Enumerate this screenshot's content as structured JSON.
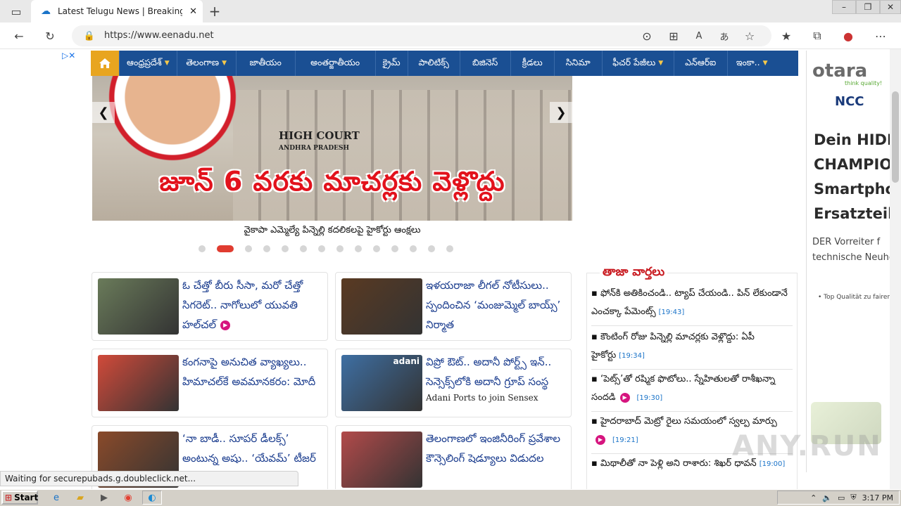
{
  "browser": {
    "tab_title": "Latest Telugu News | Breaking Ne",
    "url": "https://www.eenadu.net",
    "status_text": "Waiting for securepubads.g.doubleclick.net..."
  },
  "nav": {
    "items": [
      {
        "label": "ఆంధ్రప్రదేశ్",
        "dropdown": true
      },
      {
        "label": "తెలంగాణ",
        "dropdown": true
      },
      {
        "label": "జాతీయం",
        "dropdown": false
      },
      {
        "label": "అంతర్జాతీయం",
        "dropdown": false
      },
      {
        "label": "క్రైమ్",
        "dropdown": false
      },
      {
        "label": "పాలిటిక్స్",
        "dropdown": false
      },
      {
        "label": "బిజినెస్",
        "dropdown": false
      },
      {
        "label": "క్రీడలు",
        "dropdown": false
      },
      {
        "label": "సినిమా",
        "dropdown": false
      },
      {
        "label": "ఫీచర్ పేజీలు",
        "dropdown": true
      },
      {
        "label": "ఎన్‌ఆర్‌ఐ",
        "dropdown": false
      },
      {
        "label": "ఇంకా..",
        "dropdown": true
      }
    ]
  },
  "hero": {
    "headline": "జూన్ 6 వరకు మాచర్లకు వెళ్లొద్దు",
    "building_sign": "HIGH COURT",
    "building_sign_sub": "ANDHRA PRADESH",
    "caption": "వైకాపా ఎమ్మెల్యే పిన్నెల్లి కదలికలపై హైకోర్టు ఆంక్షలు",
    "slides": 14,
    "active_slide": 2
  },
  "cards": [
    {
      "text": "ఓ చేత్తో బీరు సీసా, మరో చేత్తో సిగరెట్‌.. నాగోలులో యువతి హల్‌చల్",
      "video": true,
      "thumb_color": "#6a7b5a"
    },
    {
      "text": "ఇళయరాజా లీగల్‌ నోటీసులు.. స్పందించిన ‘మంజుమ్మెల్‌ బాయ్స్‌’ నిర్మాత",
      "video": false,
      "thumb_color": "#5a3a22"
    },
    {
      "text": "కంగనాపై అనుచిత వ్యాఖ్యలు.. హిమాచల్‌కే అవమానకరం: మోదీ",
      "video": false,
      "thumb_color": "#d14a3a"
    },
    {
      "text": "విప్రో ఔట్‌.. అదానీ పోర్ట్స్‌ ఇన్‌.. సెన్సెక్స్‌లోకి అదానీ గ్రూప్‌ సంస్థ",
      "video": false,
      "thumb_color": "#3e6fa3",
      "subtitle": "Adani Ports to join Sensex",
      "thumb_label": "adani"
    },
    {
      "text": "‘నా బాడీ.. సూపర్‌ డీలక్స్‌’ అంటున్న అషు.. ‘యేవమ్‌’ టీజర్‌",
      "video": false,
      "thumb_color": "#8a4a2a"
    },
    {
      "text": "తెలంగాణలో ఇంజినీరింగ్‌ ప్రవేశాల కౌన్సెలింగ్‌ షెడ్యూలు విడుదల",
      "video": false,
      "thumb_color": "#b24a4a"
    }
  ],
  "latest": {
    "title": "తాజా వార్తలు",
    "items": [
      {
        "text": "ఫోన్‌కి అతికించండి.. ట్యాప్‌ చేయండి.. పిన్‌ లేకుండానే ఎంచక్కా పేమెంట్స్‌",
        "time": "[19:43]",
        "video": false
      },
      {
        "text": "కౌంటింగ్‌ రోజు పిన్నెల్లి మాచర్లకు వెళ్లొద్దు: ఏపీ హైకోర్టు",
        "time": "[19:34]",
        "video": false
      },
      {
        "text": "‘పెట్స్‌’తో రష్మిక ఫొటోలు.. స్నేహితులతో రాశీఖన్నా సందడి",
        "time": "[19:30]",
        "video": true
      },
      {
        "text": "హైదరాబాద్‌ మెట్రో రైలు సమయంలో స్వల్ప మార్పు",
        "time": "[19:21]",
        "video": true
      },
      {
        "text": "మిథాలీతో నా పెళ్లి అని రాశారు: శిఖర్‌ ధావన్‌",
        "time": "[19:00]",
        "video": false
      }
    ]
  },
  "ad": {
    "brand": "otara",
    "brand_tag": "think quality!",
    "ncc": "NCC",
    "headline": [
      "Dein HIDDE",
      "CHAMPION f",
      "Smartphor",
      "Ersatzteil"
    ],
    "sub": [
      "DER Vorreiter f",
      "technische Neuhe"
    ],
    "quality": "• Top Qualität zu fairen P"
  },
  "taskbar": {
    "start_label": "Start",
    "clock": "3:17 PM"
  },
  "watermark": "ANY.RUN"
}
